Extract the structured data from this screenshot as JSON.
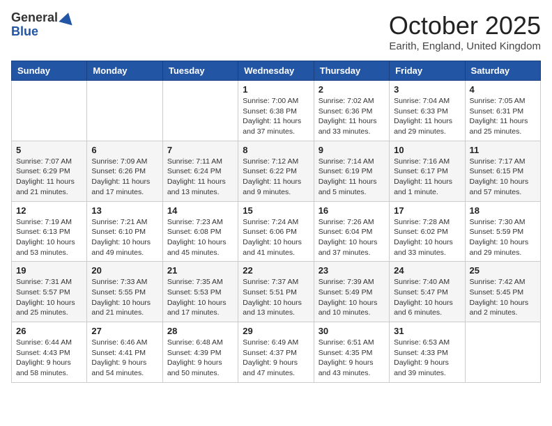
{
  "header": {
    "logo_general": "General",
    "logo_blue": "Blue",
    "month_title": "October 2025",
    "location": "Earith, England, United Kingdom"
  },
  "days_of_week": [
    "Sunday",
    "Monday",
    "Tuesday",
    "Wednesday",
    "Thursday",
    "Friday",
    "Saturday"
  ],
  "weeks": [
    [
      {
        "day": "",
        "info": ""
      },
      {
        "day": "",
        "info": ""
      },
      {
        "day": "",
        "info": ""
      },
      {
        "day": "1",
        "info": "Sunrise: 7:00 AM\nSunset: 6:38 PM\nDaylight: 11 hours\nand 37 minutes."
      },
      {
        "day": "2",
        "info": "Sunrise: 7:02 AM\nSunset: 6:36 PM\nDaylight: 11 hours\nand 33 minutes."
      },
      {
        "day": "3",
        "info": "Sunrise: 7:04 AM\nSunset: 6:33 PM\nDaylight: 11 hours\nand 29 minutes."
      },
      {
        "day": "4",
        "info": "Sunrise: 7:05 AM\nSunset: 6:31 PM\nDaylight: 11 hours\nand 25 minutes."
      }
    ],
    [
      {
        "day": "5",
        "info": "Sunrise: 7:07 AM\nSunset: 6:29 PM\nDaylight: 11 hours\nand 21 minutes."
      },
      {
        "day": "6",
        "info": "Sunrise: 7:09 AM\nSunset: 6:26 PM\nDaylight: 11 hours\nand 17 minutes."
      },
      {
        "day": "7",
        "info": "Sunrise: 7:11 AM\nSunset: 6:24 PM\nDaylight: 11 hours\nand 13 minutes."
      },
      {
        "day": "8",
        "info": "Sunrise: 7:12 AM\nSunset: 6:22 PM\nDaylight: 11 hours\nand 9 minutes."
      },
      {
        "day": "9",
        "info": "Sunrise: 7:14 AM\nSunset: 6:19 PM\nDaylight: 11 hours\nand 5 minutes."
      },
      {
        "day": "10",
        "info": "Sunrise: 7:16 AM\nSunset: 6:17 PM\nDaylight: 11 hours\nand 1 minute."
      },
      {
        "day": "11",
        "info": "Sunrise: 7:17 AM\nSunset: 6:15 PM\nDaylight: 10 hours\nand 57 minutes."
      }
    ],
    [
      {
        "day": "12",
        "info": "Sunrise: 7:19 AM\nSunset: 6:13 PM\nDaylight: 10 hours\nand 53 minutes."
      },
      {
        "day": "13",
        "info": "Sunrise: 7:21 AM\nSunset: 6:10 PM\nDaylight: 10 hours\nand 49 minutes."
      },
      {
        "day": "14",
        "info": "Sunrise: 7:23 AM\nSunset: 6:08 PM\nDaylight: 10 hours\nand 45 minutes."
      },
      {
        "day": "15",
        "info": "Sunrise: 7:24 AM\nSunset: 6:06 PM\nDaylight: 10 hours\nand 41 minutes."
      },
      {
        "day": "16",
        "info": "Sunrise: 7:26 AM\nSunset: 6:04 PM\nDaylight: 10 hours\nand 37 minutes."
      },
      {
        "day": "17",
        "info": "Sunrise: 7:28 AM\nSunset: 6:02 PM\nDaylight: 10 hours\nand 33 minutes."
      },
      {
        "day": "18",
        "info": "Sunrise: 7:30 AM\nSunset: 5:59 PM\nDaylight: 10 hours\nand 29 minutes."
      }
    ],
    [
      {
        "day": "19",
        "info": "Sunrise: 7:31 AM\nSunset: 5:57 PM\nDaylight: 10 hours\nand 25 minutes."
      },
      {
        "day": "20",
        "info": "Sunrise: 7:33 AM\nSunset: 5:55 PM\nDaylight: 10 hours\nand 21 minutes."
      },
      {
        "day": "21",
        "info": "Sunrise: 7:35 AM\nSunset: 5:53 PM\nDaylight: 10 hours\nand 17 minutes."
      },
      {
        "day": "22",
        "info": "Sunrise: 7:37 AM\nSunset: 5:51 PM\nDaylight: 10 hours\nand 13 minutes."
      },
      {
        "day": "23",
        "info": "Sunrise: 7:39 AM\nSunset: 5:49 PM\nDaylight: 10 hours\nand 10 minutes."
      },
      {
        "day": "24",
        "info": "Sunrise: 7:40 AM\nSunset: 5:47 PM\nDaylight: 10 hours\nand 6 minutes."
      },
      {
        "day": "25",
        "info": "Sunrise: 7:42 AM\nSunset: 5:45 PM\nDaylight: 10 hours\nand 2 minutes."
      }
    ],
    [
      {
        "day": "26",
        "info": "Sunrise: 6:44 AM\nSunset: 4:43 PM\nDaylight: 9 hours\nand 58 minutes."
      },
      {
        "day": "27",
        "info": "Sunrise: 6:46 AM\nSunset: 4:41 PM\nDaylight: 9 hours\nand 54 minutes."
      },
      {
        "day": "28",
        "info": "Sunrise: 6:48 AM\nSunset: 4:39 PM\nDaylight: 9 hours\nand 50 minutes."
      },
      {
        "day": "29",
        "info": "Sunrise: 6:49 AM\nSunset: 4:37 PM\nDaylight: 9 hours\nand 47 minutes."
      },
      {
        "day": "30",
        "info": "Sunrise: 6:51 AM\nSunset: 4:35 PM\nDaylight: 9 hours\nand 43 minutes."
      },
      {
        "day": "31",
        "info": "Sunrise: 6:53 AM\nSunset: 4:33 PM\nDaylight: 9 hours\nand 39 minutes."
      },
      {
        "day": "",
        "info": ""
      }
    ]
  ]
}
